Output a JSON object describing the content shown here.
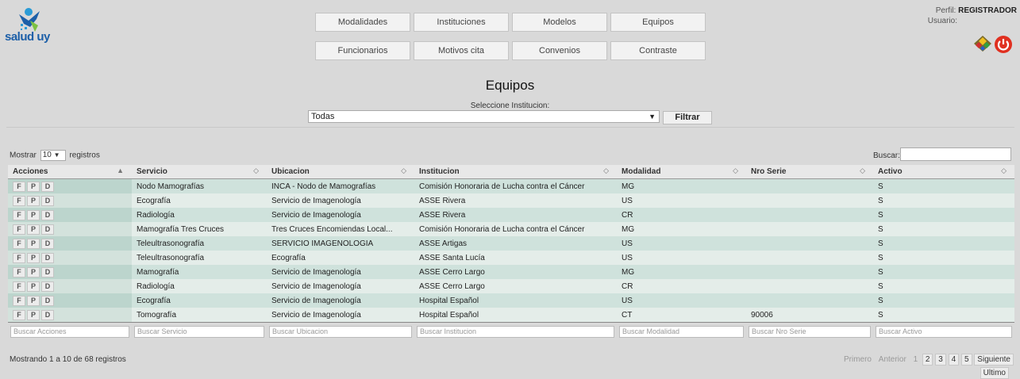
{
  "logo": {
    "text": "salud uy"
  },
  "nav": [
    "Modalidades",
    "Instituciones",
    "Modelos",
    "Equipos",
    "Funcionarios",
    "Motivos cita",
    "Convenios",
    "Contraste"
  ],
  "profile": {
    "perfil_label": "Perfil:",
    "perfil_value": "REGISTRADOR",
    "usuario_label": "Usuario:"
  },
  "title": "Equipos",
  "institution": {
    "label": "Seleccione Institucion:",
    "selected": "Todas",
    "filter_button": "Filtrar"
  },
  "controls": {
    "show_label": "Mostrar",
    "length_value": "10",
    "records_label": "registros",
    "search_label": "Buscar:"
  },
  "table": {
    "headers": [
      "Acciones",
      "Servicio",
      "Ubicacion",
      "Institucion",
      "Modalidad",
      "Nro Serie",
      "Activo"
    ],
    "action_buttons": [
      "F",
      "P",
      "D"
    ],
    "rows": [
      [
        "Nodo Mamografías",
        "INCA - Nodo de Mamografías",
        "Comisión Honoraria de Lucha contra el Cáncer",
        "MG",
        "",
        "S"
      ],
      [
        "Ecografía",
        "Servicio de Imagenología",
        "ASSE Rivera",
        "US",
        "",
        "S"
      ],
      [
        "Radiología",
        "Servicio de Imagenología",
        "ASSE Rivera",
        "CR",
        "",
        "S"
      ],
      [
        "Mamografía Tres Cruces",
        "Tres Cruces Encomiendas Local...",
        "Comisión Honoraria de Lucha contra el Cáncer",
        "MG",
        "",
        "S"
      ],
      [
        "Teleultrasonografía",
        "SERVICIO IMAGENOLOGIA",
        "ASSE Artigas",
        "US",
        "",
        "S"
      ],
      [
        "Teleultrasonografía",
        "Ecografía",
        "ASSE Santa Lucía",
        "US",
        "",
        "S"
      ],
      [
        "Mamografía",
        "Servicio de Imagenología",
        "ASSE Cerro Largo",
        "MG",
        "",
        "S"
      ],
      [
        "Radiología",
        "Servicio de Imagenología",
        "ASSE Cerro Largo",
        "CR",
        "",
        "S"
      ],
      [
        "Ecografía",
        "Servicio de Imagenología",
        "Hospital Español",
        "US",
        "",
        "S"
      ],
      [
        "Tomografía",
        "Servicio de Imagenología",
        "Hospital Español",
        "CT",
        "90006",
        "S"
      ]
    ],
    "footer_placeholders": [
      "Buscar Acciones",
      "Buscar Servicio",
      "Buscar Ubicacion",
      "Buscar Institucion",
      "Buscar Modalidad",
      "Buscar Nro Serie",
      "Buscar Activo"
    ]
  },
  "info": "Mostrando 1 a 10 de 68 registros",
  "pagination": {
    "first": "Primero",
    "prev": "Anterior",
    "pages": [
      "1",
      "2",
      "3",
      "4",
      "5"
    ],
    "next": "Siguiente",
    "last": "Ultimo"
  },
  "colors": {
    "row_odd": "#cfe2dc",
    "row_even": "#e4ede9",
    "logo_blue": "#1c5fa8",
    "power_red": "#e03020"
  }
}
